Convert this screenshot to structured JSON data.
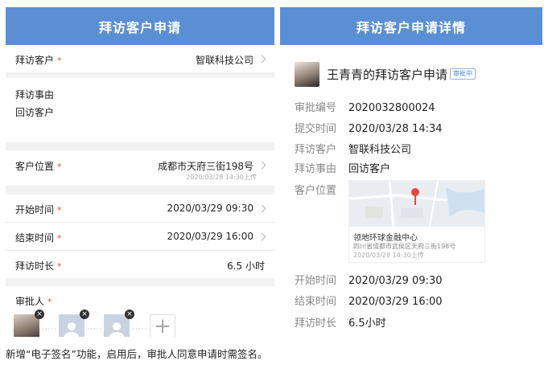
{
  "left": {
    "header_title": "拜访客户申请",
    "customer": {
      "label": "拜访客户",
      "required": "*",
      "value": "智联科技公司"
    },
    "reason": {
      "label": "拜访事由",
      "value": "回访客户"
    },
    "location": {
      "label": "客户位置",
      "required": "*",
      "value": "成都市天府三街198号",
      "timestamp": "2020/03/28 14:30上传"
    },
    "start": {
      "label": "开始时间",
      "required": "*",
      "value": "2020/03/29 09:30"
    },
    "end": {
      "label": "结束时间",
      "required": "*",
      "value": "2020/03/29 16:00"
    },
    "duration": {
      "label": "拜访时长",
      "required": "*",
      "value": "6.5 小时"
    },
    "approver": {
      "label": "审批人",
      "required": "*",
      "close_glyph": "×",
      "dots": "·····",
      "add_glyph": "+"
    }
  },
  "right": {
    "header_title": "拜访客户申请详情",
    "title": "王青青的拜访客户申请",
    "badge": "审批中",
    "fields": [
      {
        "k": "审批编号",
        "v": "2020032800024"
      },
      {
        "k": "提交时间",
        "v": "2020/03/28 14:34"
      },
      {
        "k": "拜访客户",
        "v": "智联科技公司"
      },
      {
        "k": "拜访事由",
        "v": "回访客户"
      },
      {
        "k": "客户位置",
        "v": ""
      },
      {
        "k": "开始时间",
        "v": "2020/03/29 09:30"
      },
      {
        "k": "结束时间",
        "v": "2020/03/29 16:00"
      },
      {
        "k": "拜访时长",
        "v": "6.5小时"
      }
    ],
    "map": {
      "place": "领地环球金融中心",
      "address": "四川省成都市武侯区天府三街198号",
      "time": "2020/03/28 14:30上传"
    }
  },
  "caption": "新增“电子签名”功能，启用后，审批人同意申请时需签名。",
  "colors": {
    "header": "#5b8fd4",
    "required": "#e24a4a",
    "badge": "#4a80d0"
  }
}
